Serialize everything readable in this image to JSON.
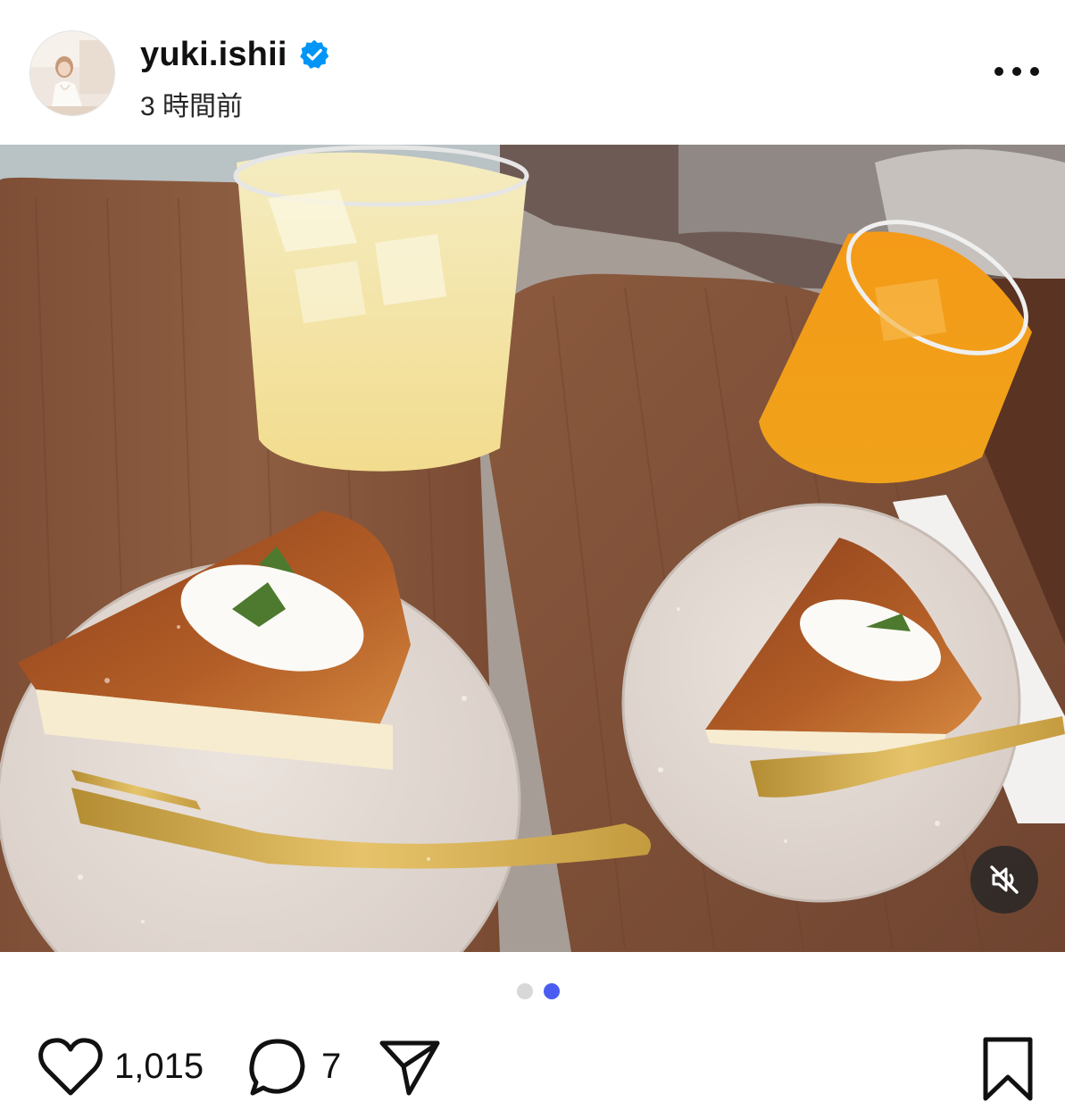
{
  "post": {
    "username": "yuki.ishii",
    "verified": true,
    "timestamp": "3 時間前"
  },
  "media": {
    "carousel_total": 2,
    "carousel_active_index": 2,
    "muted": true
  },
  "actions": {
    "like_count": "1,015",
    "comment_count": "7"
  },
  "colors": {
    "verified_badge": "#0095f6",
    "active_dot": "#4a5df0",
    "inactive_dot": "#d8d8d8",
    "icon": "#111111"
  },
  "icons": {
    "more": "more-horizontal-icon",
    "mute": "speaker-muted-icon",
    "like": "heart-icon",
    "comment": "comment-bubble-icon",
    "share": "paper-plane-icon",
    "save": "bookmark-icon"
  }
}
